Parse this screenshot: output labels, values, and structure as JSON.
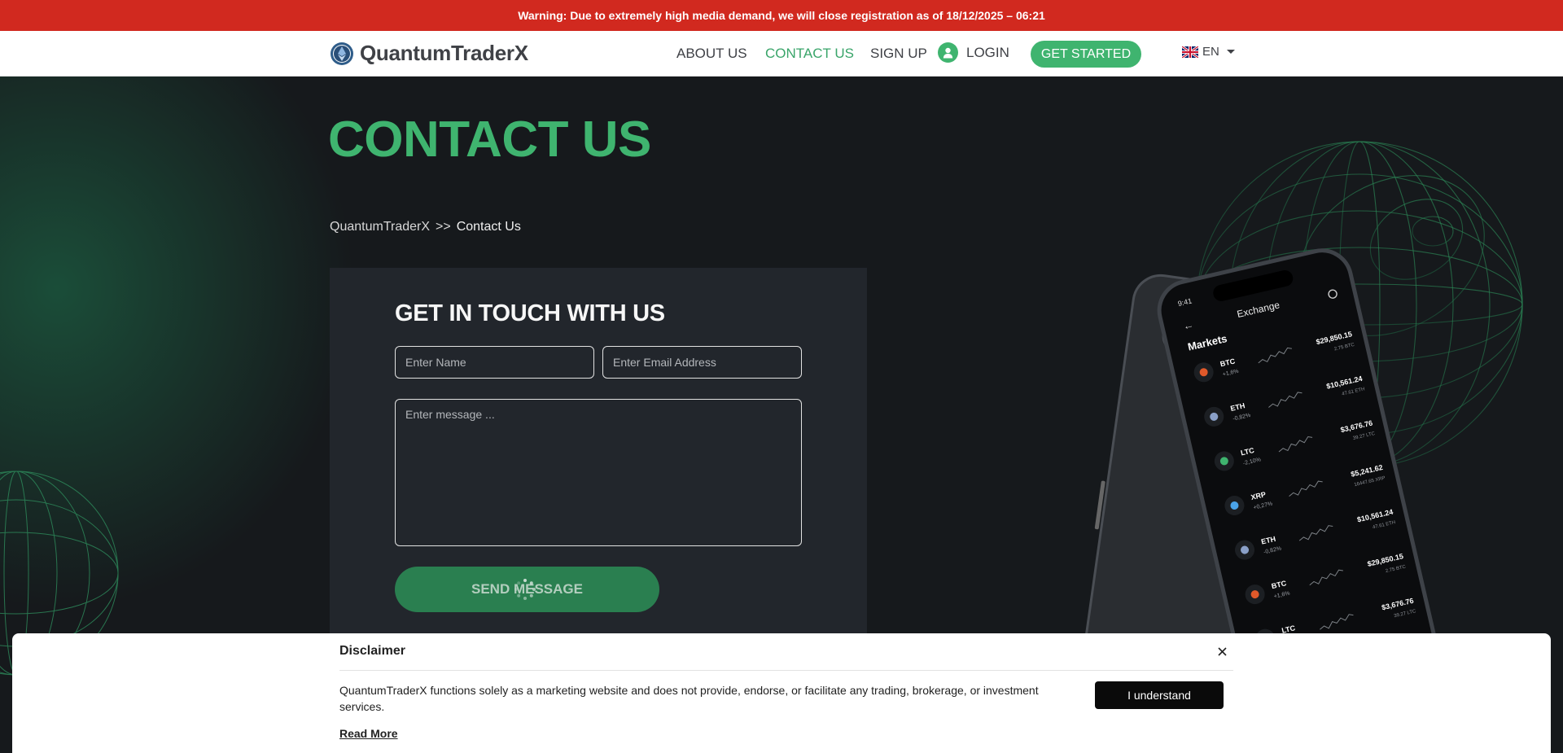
{
  "warning": {
    "text": "Warning: Due to extremely high media demand, we will close registration as of 18/12/2025 – 06:21"
  },
  "header": {
    "brand": "QuantumTraderX",
    "nav": {
      "about": "ABOUT US",
      "contact": "CONTACT US",
      "signup": "SIGN UP",
      "login": "LOGIN"
    },
    "cta_label": "GET STARTED",
    "language": "EN",
    "active_nav": "contact",
    "icons": [
      "logo-icon",
      "user-icon",
      "uk-flag-icon",
      "chevron-down-icon"
    ]
  },
  "page": {
    "title": "CONTACT US",
    "breadcrumb": {
      "home": "QuantumTraderX",
      "separator": ">>",
      "current": "Contact Us"
    }
  },
  "form": {
    "title": "GET IN TOUCH WITH US",
    "name_placeholder": "Enter Name",
    "email_placeholder": "Enter Email Address",
    "message_placeholder": "Enter message ...",
    "submit_label": "SEND MESSAGE",
    "submit_state": "loading"
  },
  "phone_screen": {
    "time": "9:41",
    "title": "Exchange",
    "section": "Markets",
    "markets": [
      {
        "symbol": "BTC",
        "change": "+1,6%",
        "price": "$29,850.15",
        "amount": "2.75 BTC",
        "color": "#e0592a"
      },
      {
        "symbol": "ETH",
        "change": "-0,82%",
        "price": "$10,561.24",
        "amount": "47.61 ETH",
        "color": "#8aa0c8"
      },
      {
        "symbol": "LTC",
        "change": "-2,10%",
        "price": "$3,676.76",
        "amount": "39.27 LTC",
        "color": "#3fb46f"
      },
      {
        "symbol": "XRP",
        "change": "+0,27%",
        "price": "$5,241.62",
        "amount": "16447.65 XRP",
        "color": "#4aa3e8"
      },
      {
        "symbol": "ETH",
        "change": "-0,82%",
        "price": "$10,561.24",
        "amount": "47.61 ETH",
        "color": "#8aa0c8"
      },
      {
        "symbol": "BTC",
        "change": "+1,6%",
        "price": "$29,850.15",
        "amount": "2.75 BTC",
        "color": "#e0592a"
      },
      {
        "symbol": "LTC",
        "change": "",
        "price": "$3,676.76",
        "amount": "39.27 LTC",
        "color": "#3fb46f"
      }
    ]
  },
  "disclaimer": {
    "title": "Disclaimer",
    "body": "QuantumTraderX functions solely as a marketing website and does not provide, endorse, or facilitate any trading, brokerage, or investment services.",
    "read_more": "Read More",
    "accept_label": "I understand"
  },
  "colors": {
    "warning_bg": "#d1291f",
    "accent_green": "#3fb46f",
    "hero_bg": "#16191c",
    "panel_bg": "#23272d"
  }
}
